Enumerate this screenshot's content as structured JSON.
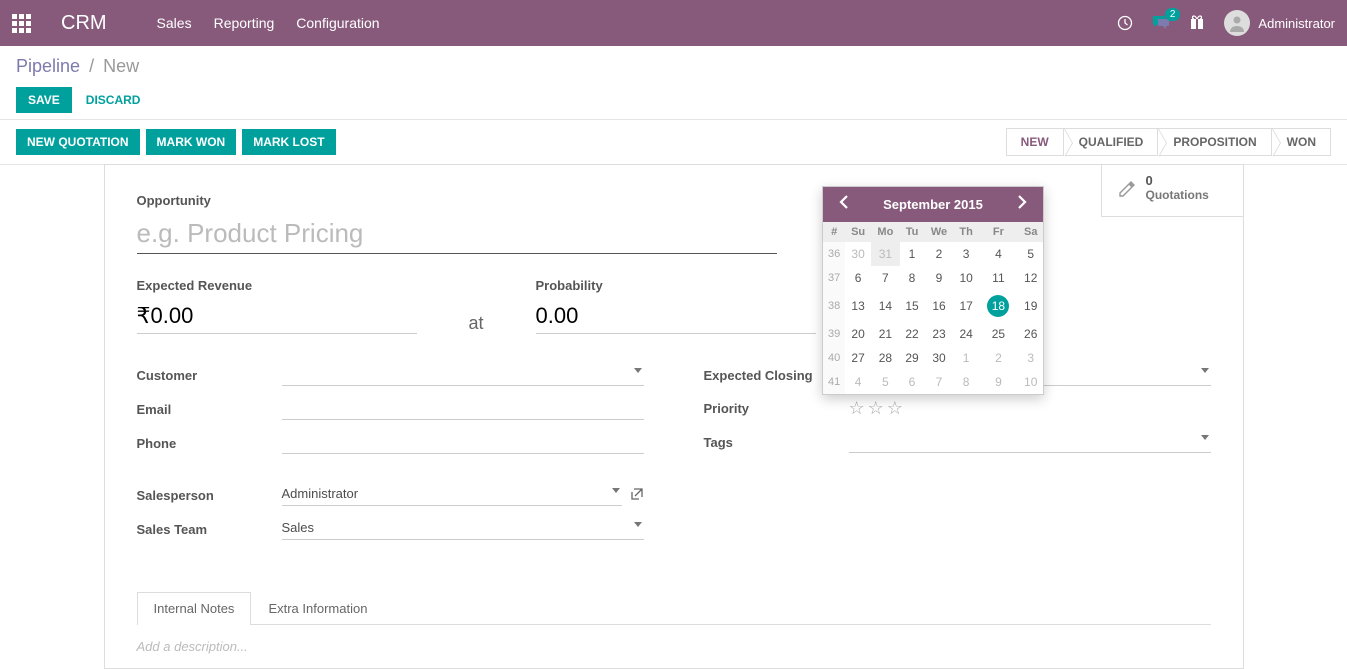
{
  "header": {
    "app_title": "CRM",
    "menu": [
      "Sales",
      "Reporting",
      "Configuration"
    ],
    "chat_count": "2",
    "user": "Administrator"
  },
  "breadcrumb": {
    "root": "Pipeline",
    "current": "New"
  },
  "buttons": {
    "save": "SAVE",
    "discard": "DISCARD",
    "new_quotation": "NEW QUOTATION",
    "mark_won": "MARK WON",
    "mark_lost": "MARK LOST"
  },
  "status": {
    "steps": [
      "NEW",
      "QUALIFIED",
      "PROPOSITION",
      "WON"
    ],
    "active_index": 0
  },
  "stat_button": {
    "count": "0",
    "label": "Quotations"
  },
  "form": {
    "opportunity_label": "Opportunity",
    "opportunity_placeholder": "e.g. Product Pricing",
    "expected_revenue_label": "Expected Revenue",
    "expected_revenue_value": "₹0.00",
    "at_label": "at",
    "probability_label": "Probability",
    "probability_value": "0.00",
    "pct_symbol": "%",
    "customer_label": "Customer",
    "email_label": "Email",
    "phone_label": "Phone",
    "salesperson_label": "Salesperson",
    "salesperson_value": "Administrator",
    "sales_team_label": "Sales Team",
    "sales_team_value": "Sales",
    "expected_closing_label": "Expected Closing",
    "expected_closing_value": "09/18/2015",
    "priority_label": "Priority",
    "tags_label": "Tags"
  },
  "tabs": {
    "internal_notes": "Internal Notes",
    "extra_info": "Extra Information",
    "placeholder": "Add a description..."
  },
  "datepicker": {
    "title": "September 2015",
    "dow_header": "#",
    "dow": [
      "Su",
      "Mo",
      "Tu",
      "We",
      "Th",
      "Fr",
      "Sa"
    ],
    "weeks": [
      {
        "num": "36",
        "days": [
          {
            "d": "30",
            "o": true
          },
          {
            "d": "31",
            "o": true,
            "hov": true
          },
          {
            "d": "1"
          },
          {
            "d": "2"
          },
          {
            "d": "3"
          },
          {
            "d": "4"
          },
          {
            "d": "5"
          }
        ]
      },
      {
        "num": "37",
        "days": [
          {
            "d": "6"
          },
          {
            "d": "7"
          },
          {
            "d": "8"
          },
          {
            "d": "9"
          },
          {
            "d": "10"
          },
          {
            "d": "11"
          },
          {
            "d": "12"
          }
        ]
      },
      {
        "num": "38",
        "days": [
          {
            "d": "13"
          },
          {
            "d": "14"
          },
          {
            "d": "15"
          },
          {
            "d": "16"
          },
          {
            "d": "17"
          },
          {
            "d": "18",
            "sel": true
          },
          {
            "d": "19"
          }
        ]
      },
      {
        "num": "39",
        "days": [
          {
            "d": "20"
          },
          {
            "d": "21"
          },
          {
            "d": "22"
          },
          {
            "d": "23"
          },
          {
            "d": "24"
          },
          {
            "d": "25"
          },
          {
            "d": "26"
          }
        ]
      },
      {
        "num": "40",
        "days": [
          {
            "d": "27"
          },
          {
            "d": "28"
          },
          {
            "d": "29"
          },
          {
            "d": "30"
          },
          {
            "d": "1",
            "o": true
          },
          {
            "d": "2",
            "o": true
          },
          {
            "d": "3",
            "o": true
          }
        ]
      },
      {
        "num": "41",
        "days": [
          {
            "d": "4",
            "o": true
          },
          {
            "d": "5",
            "o": true
          },
          {
            "d": "6",
            "o": true
          },
          {
            "d": "7",
            "o": true
          },
          {
            "d": "8",
            "o": true
          },
          {
            "d": "9",
            "o": true
          },
          {
            "d": "10",
            "o": true
          }
        ]
      }
    ]
  }
}
